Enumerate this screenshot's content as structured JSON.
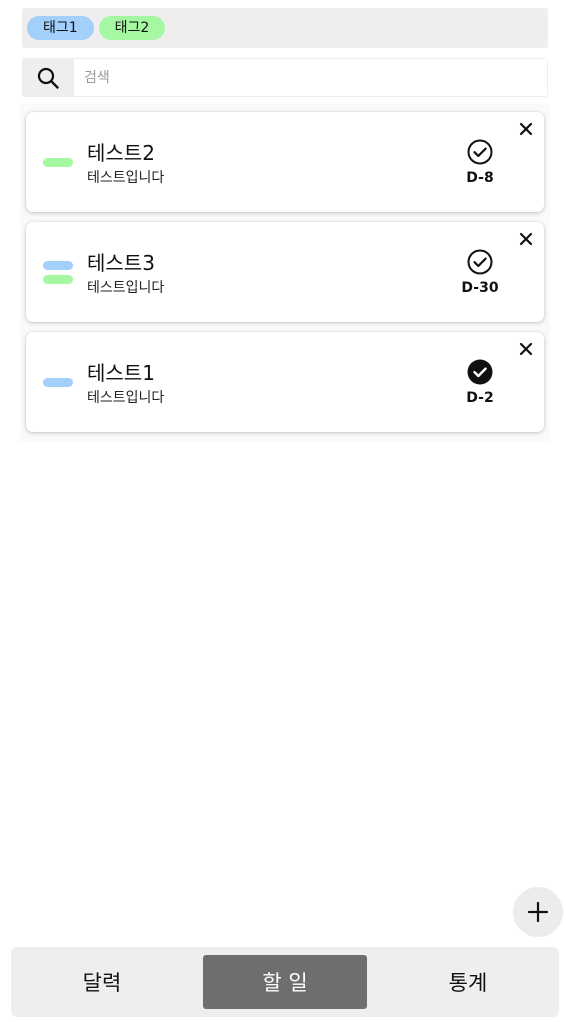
{
  "tags": [
    {
      "label": "태그1",
      "color": "#a3cffb"
    },
    {
      "label": "태그2",
      "color": "#a5f7a2"
    }
  ],
  "search": {
    "placeholder": "검색",
    "value": "",
    "icon": "search-icon"
  },
  "todos": [
    {
      "title": "테스트2",
      "description": "테스트입니다",
      "dday": "D-8",
      "completed": false,
      "tag_colors": [
        "#a5f7a2"
      ]
    },
    {
      "title": "테스트3",
      "description": "테스트입니다",
      "dday": "D-30",
      "completed": false,
      "tag_colors": [
        "#a3cffb",
        "#a5f7a2"
      ]
    },
    {
      "title": "테스트1",
      "description": "테스트입니다",
      "dday": "D-2",
      "completed": true,
      "tag_colors": [
        "#a3cffb"
      ]
    }
  ],
  "fab": {
    "icon": "plus-icon"
  },
  "nav": {
    "tabs": [
      {
        "label": "달력",
        "active": false
      },
      {
        "label": "할 일",
        "active": true
      },
      {
        "label": "통계",
        "active": false
      }
    ]
  },
  "colors": {
    "panel_bg": "#eeeeee",
    "active_tab": "#6e6e6e",
    "card_bg": "#ffffff"
  }
}
